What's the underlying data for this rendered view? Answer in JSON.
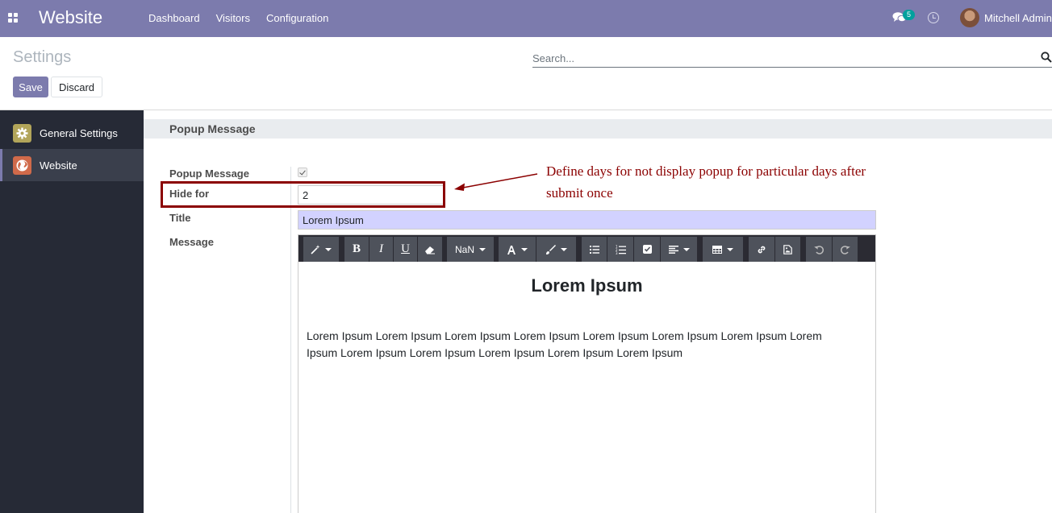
{
  "navbar": {
    "app_title": "Website",
    "menu": [
      "Dashboard",
      "Visitors",
      "Configuration"
    ],
    "chat_badge": "5",
    "user_name": "Mitchell Admin",
    "icons": {
      "apps": "apps-grid-icon",
      "chat": "chat-icon",
      "clock": "clock-icon"
    },
    "color": "#7c7bad"
  },
  "control_panel": {
    "title": "Settings",
    "save_label": "Save",
    "discard_label": "Discard",
    "search_placeholder": "Search..."
  },
  "sidebar": {
    "items": [
      {
        "label": "General Settings",
        "icon": "gear-icon",
        "active": false
      },
      {
        "label": "Website",
        "icon": "globe-icon",
        "active": true
      }
    ]
  },
  "section": {
    "title": "Popup Message",
    "fields": {
      "popup_message": {
        "label": "Popup Message",
        "checked": true
      },
      "hide_for": {
        "label": "Hide for",
        "value": "2"
      },
      "title": {
        "label": "Title",
        "value": "Lorem Ipsum"
      },
      "message": {
        "label": "Message"
      }
    }
  },
  "editor": {
    "toolbar": {
      "font_size": "NaN",
      "icons": [
        "magic-wand-icon",
        "bold-icon",
        "italic-icon",
        "underline-icon",
        "eraser-icon",
        "font-size-dropdown",
        "font-color-icon",
        "paint-brush-icon",
        "unordered-list-icon",
        "ordered-list-icon",
        "checklist-icon",
        "align-icon",
        "table-icon",
        "link-icon",
        "image-icon",
        "undo-icon",
        "redo-icon"
      ],
      "bold": "B",
      "italic": "I",
      "underline": "U"
    },
    "heading": "Lorem Ipsum",
    "paragraph": "Lorem Ipsum Lorem Ipsum Lorem Ipsum Lorem Ipsum Lorem Ipsum Lorem Ipsum Lorem Ipsum Lorem Ipsum Lorem Ipsum Lorem Ipsum Lorem Ipsum Lorem Ipsum Lorem Ipsum"
  },
  "annotation": {
    "text": "Define days for not display popup for particular days after submit once",
    "color": "#8b0000"
  }
}
